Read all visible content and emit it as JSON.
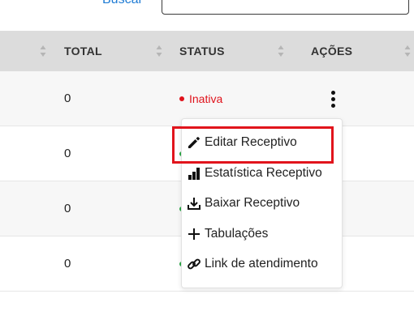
{
  "search": {
    "link_label": "Buscar",
    "input_value": ""
  },
  "table": {
    "headers": {
      "total": "TOTAL",
      "status": "STATUS",
      "actions": "AÇÕES"
    },
    "rows": [
      {
        "total": "0",
        "status": "Inativa",
        "status_color": "#e0121b"
      },
      {
        "total": "0",
        "status": "",
        "status_color": "#27a844"
      },
      {
        "total": "0",
        "status": "",
        "status_color": "#27a844"
      },
      {
        "total": "0",
        "status": "",
        "status_color": "#27a844"
      }
    ]
  },
  "actions_menu": {
    "items": [
      {
        "label": "Editar Receptivo",
        "icon": "pencil-icon"
      },
      {
        "label": "Estatística Receptivo",
        "icon": "bar-chart-icon"
      },
      {
        "label": "Baixar Receptivo",
        "icon": "download-icon"
      },
      {
        "label": "Tabulações",
        "icon": "plus-icon"
      },
      {
        "label": "Link de atendimento",
        "icon": "link-icon"
      }
    ],
    "highlighted_item": "Editar Receptivo",
    "highlight_color": "#e1141c"
  }
}
